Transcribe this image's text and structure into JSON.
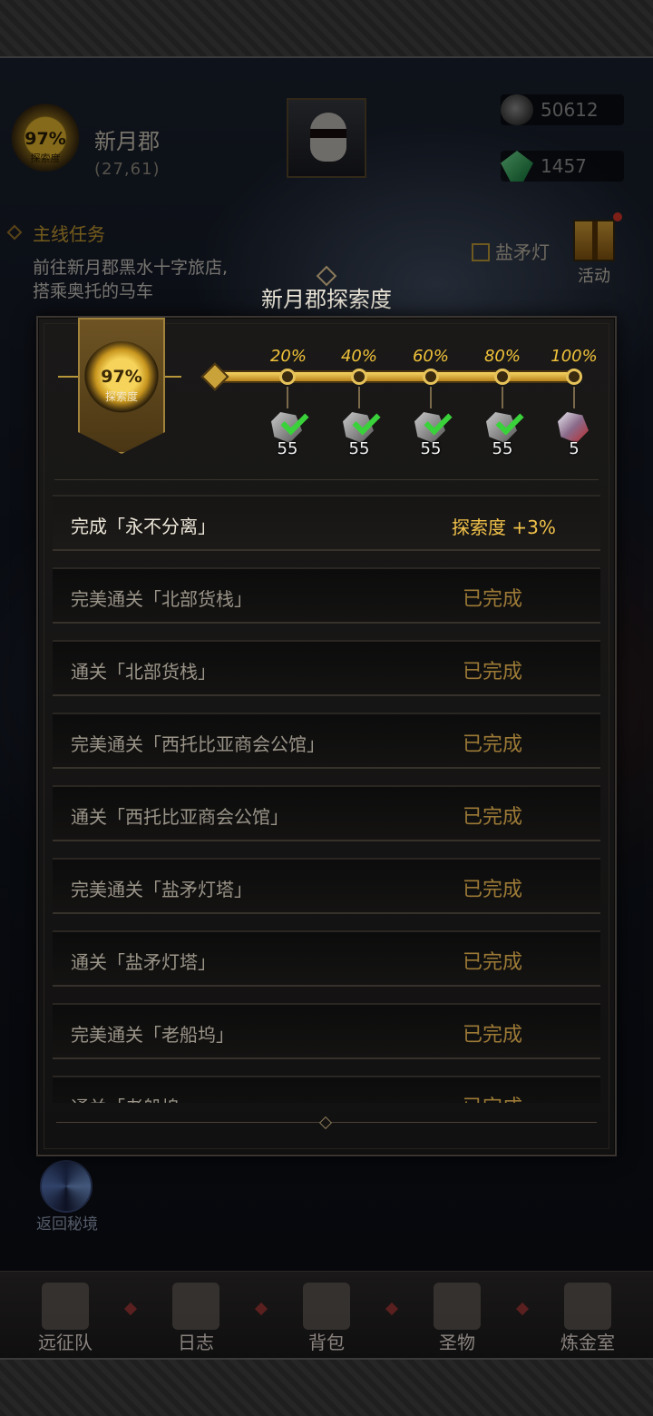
{
  "region": {
    "exploration_pct": "97%",
    "exploration_label": "探索度",
    "name": "新月郡",
    "coords": "(27,61)"
  },
  "resources": [
    {
      "icon": "stone-icon",
      "value": "50612"
    },
    {
      "icon": "emerald-icon",
      "value": "1457"
    }
  ],
  "quest": {
    "title": "主线任务",
    "text_line1": "前往新月郡黑水十字旅店,",
    "text_line2": "搭乘奥托的马车",
    "right_text": "盐矛灯"
  },
  "activity": {
    "label": "活动"
  },
  "return_portal": {
    "label": "返回秘境"
  },
  "nav": [
    {
      "label": "远征队",
      "icon": "horned-helmet-icon"
    },
    {
      "label": "日志",
      "icon": "journal-icon"
    },
    {
      "label": "背包",
      "icon": "backpack-icon"
    },
    {
      "label": "圣物",
      "icon": "relic-icon"
    },
    {
      "label": "炼金室",
      "icon": "alchemy-icon"
    }
  ],
  "modal": {
    "title": "新月郡探索度",
    "badge_pct": "97%",
    "badge_label": "探索度",
    "milestones": [
      {
        "pct": "20%",
        "count": "55",
        "claimed": true,
        "icon": "silver-ore-icon"
      },
      {
        "pct": "40%",
        "count": "55",
        "claimed": true,
        "icon": "silver-ore-icon"
      },
      {
        "pct": "60%",
        "count": "55",
        "claimed": true,
        "icon": "silver-ore-icon"
      },
      {
        "pct": "80%",
        "count": "55",
        "claimed": true,
        "icon": "silver-ore-icon"
      },
      {
        "pct": "100%",
        "count": "5",
        "claimed": false,
        "icon": "crystal-icon"
      }
    ],
    "tasks": [
      {
        "text": "完成「永不分离」",
        "status": "探索度 +3%"
      },
      {
        "text": "完美通关「北部货栈」",
        "status": "已完成"
      },
      {
        "text": "通关「北部货栈」",
        "status": "已完成"
      },
      {
        "text": "完美通关「西托比亚商会公馆」",
        "status": "已完成"
      },
      {
        "text": "通关「西托比亚商会公馆」",
        "status": "已完成"
      },
      {
        "text": "完美通关「盐矛灯塔」",
        "status": "已完成"
      },
      {
        "text": "通关「盐矛灯塔」",
        "status": "已完成"
      },
      {
        "text": "完美通关「老船坞」",
        "status": "已完成"
      },
      {
        "text": "通关「老船坞」",
        "status": "已完成"
      }
    ]
  }
}
